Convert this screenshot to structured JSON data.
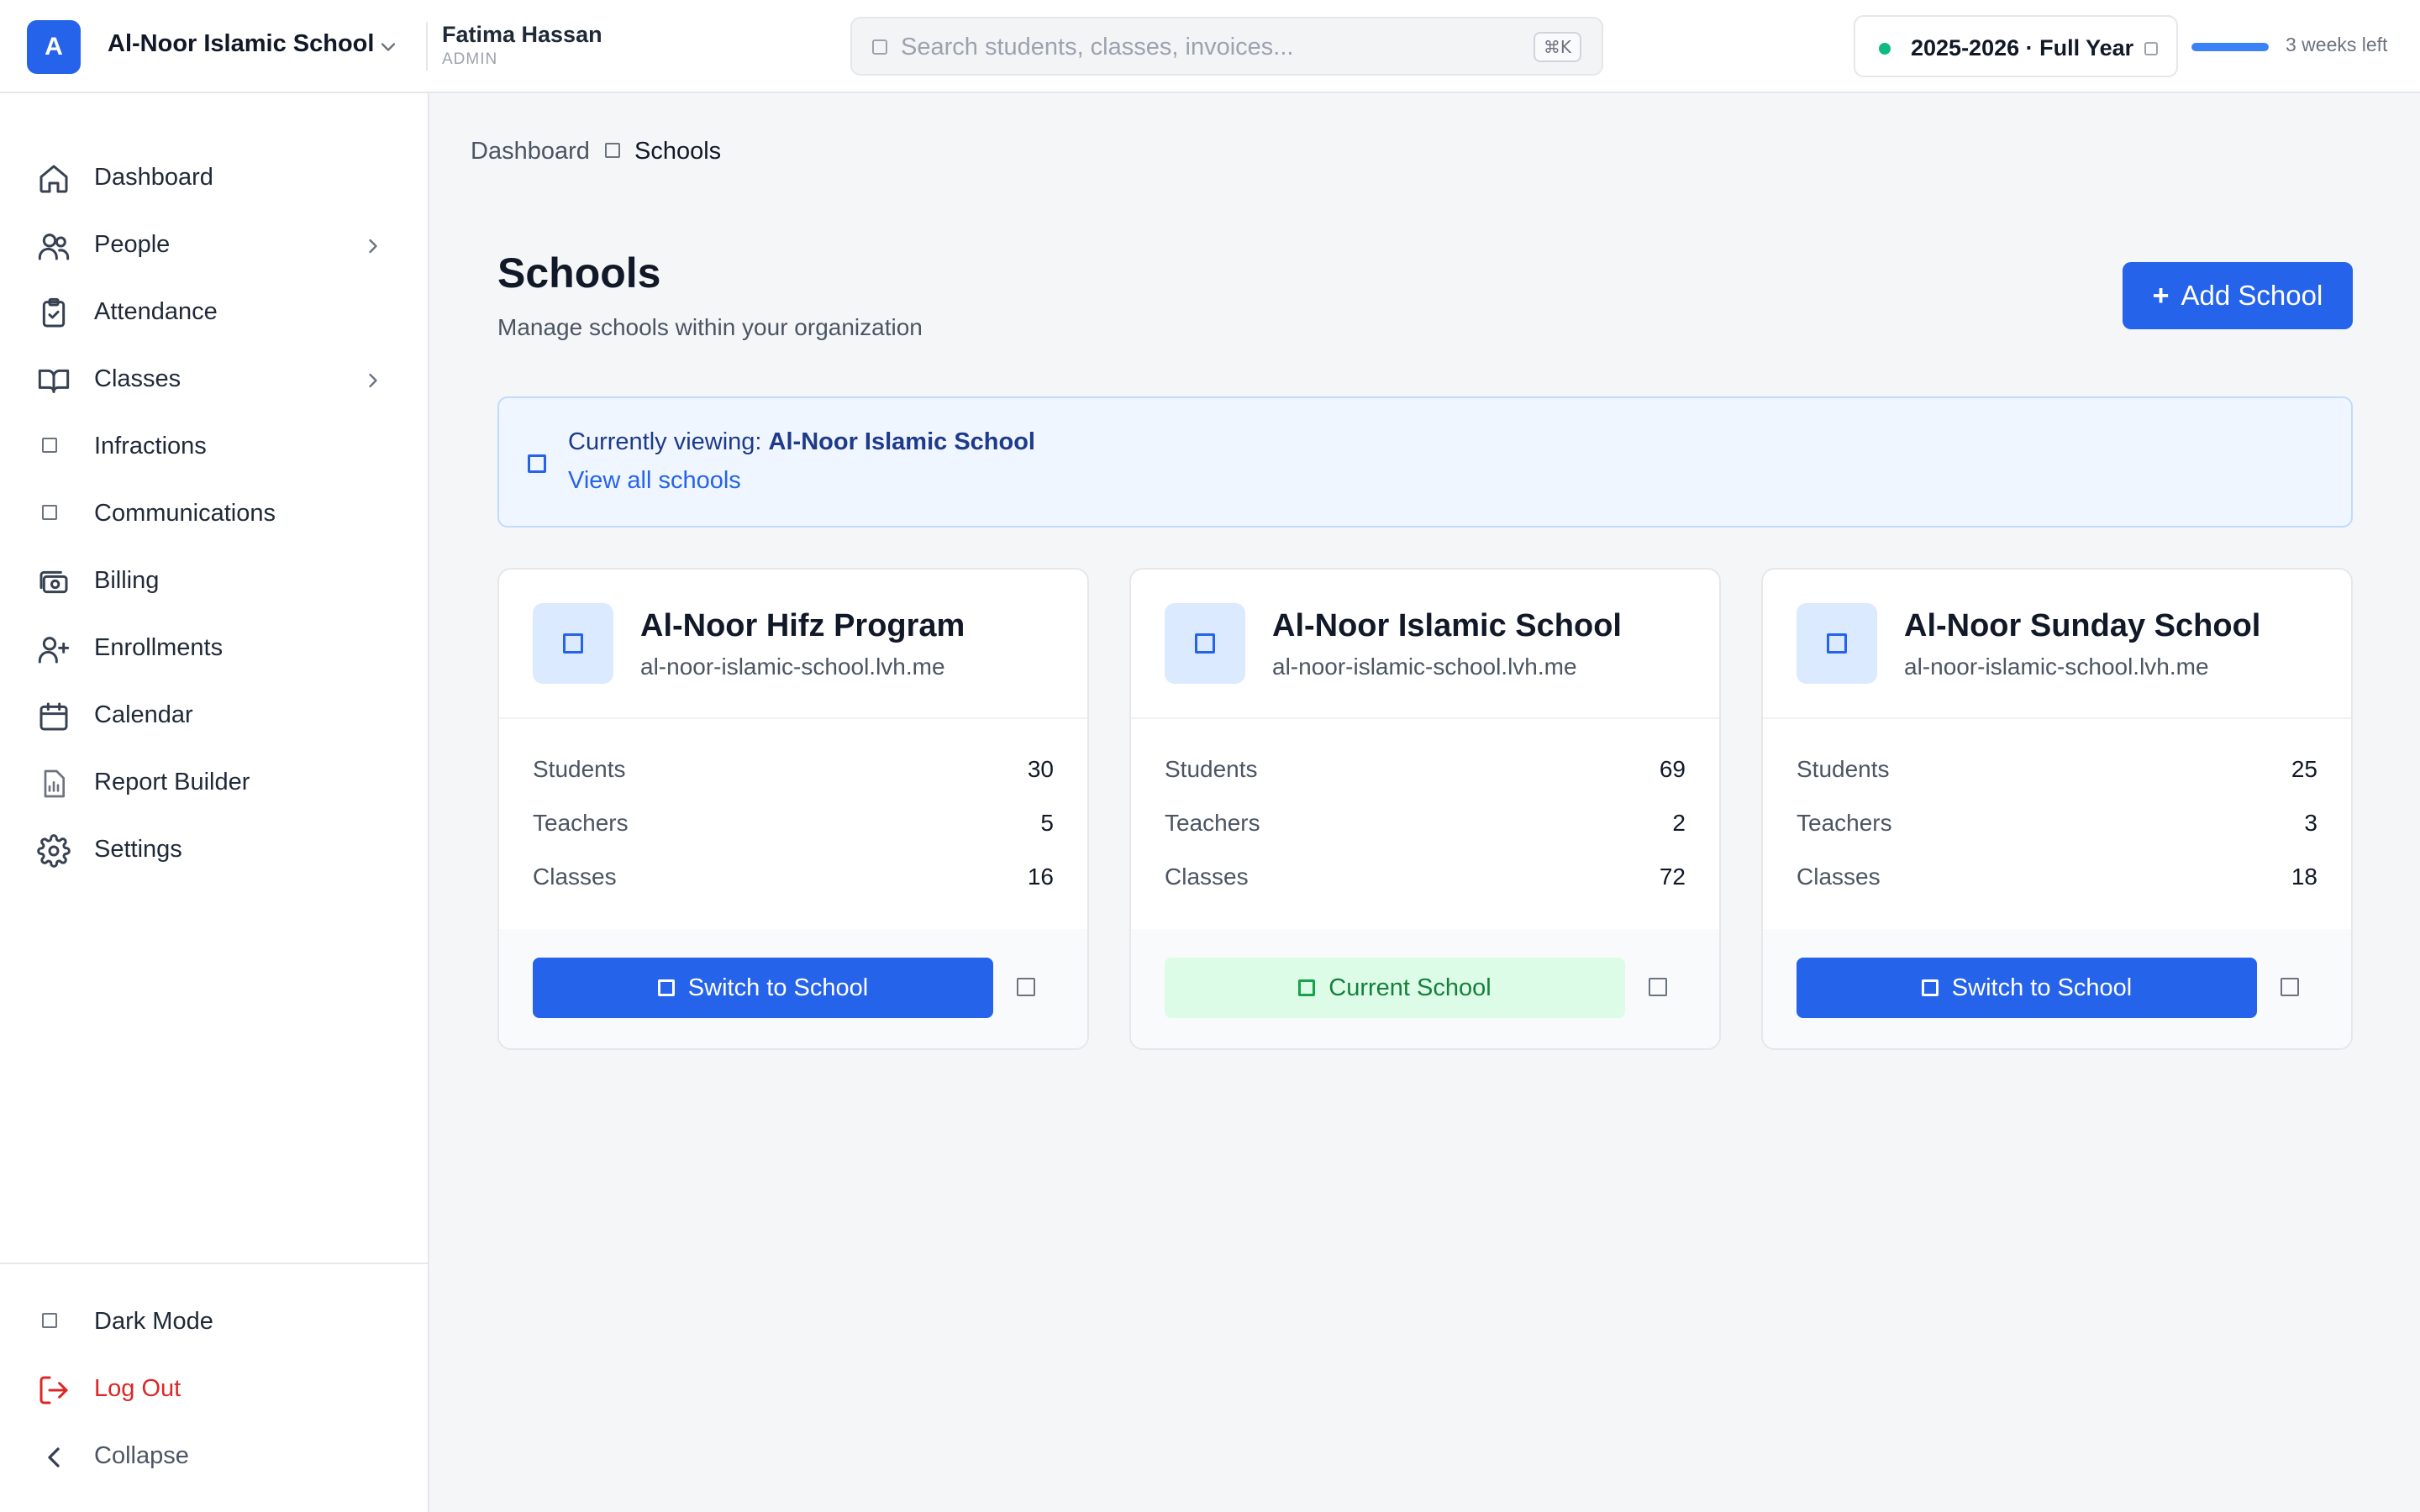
{
  "header": {
    "org_initial": "A",
    "org_name": "Al-Noor Islamic School",
    "user_name": "Fatima Hassan",
    "user_role": "ADMIN",
    "search_placeholder": "Search students, classes, invoices...",
    "search_shortcut": "⌘K",
    "academic_year": "2025-2026 · Full Year",
    "year_status_color": "#10b981",
    "year_progress_percent": 100,
    "time_left": "3 weeks left"
  },
  "sidebar": {
    "items": [
      {
        "label": "Dashboard",
        "icon": "home-icon"
      },
      {
        "label": "People",
        "icon": "users-icon",
        "has_submenu": true
      },
      {
        "label": "Attendance",
        "icon": "clipboard-check-icon"
      },
      {
        "label": "Classes",
        "icon": "book-open-icon",
        "has_submenu": true
      },
      {
        "label": "Infractions",
        "icon": "infractions-icon"
      },
      {
        "label": "Communications",
        "icon": "communications-icon"
      },
      {
        "label": "Billing",
        "icon": "billing-icon"
      },
      {
        "label": "Enrollments",
        "icon": "user-plus-icon"
      },
      {
        "label": "Calendar",
        "icon": "calendar-icon"
      },
      {
        "label": "Report Builder",
        "icon": "report-icon"
      },
      {
        "label": "Settings",
        "icon": "gear-icon"
      }
    ],
    "bottom": {
      "dark_mode": "Dark Mode",
      "log_out": "Log Out",
      "collapse": "Collapse"
    }
  },
  "breadcrumb": {
    "home": "Dashboard",
    "current": "Schools"
  },
  "page": {
    "title": "Schools",
    "subtitle": "Manage schools within your organization",
    "add_button": "Add School"
  },
  "viewing": {
    "prefix": "Currently viewing:",
    "school": "Al-Noor Islamic School",
    "link": "View all schools"
  },
  "schools": [
    {
      "name": "Al-Noor Hifz Program",
      "domain": "al-noor-islamic-school.lvh.me",
      "stats": [
        {
          "label": "Students",
          "value": "30"
        },
        {
          "label": "Teachers",
          "value": "5"
        },
        {
          "label": "Classes",
          "value": "16"
        }
      ],
      "action": "Switch to School",
      "is_current": false
    },
    {
      "name": "Al-Noor Islamic School",
      "domain": "al-noor-islamic-school.lvh.me",
      "stats": [
        {
          "label": "Students",
          "value": "69"
        },
        {
          "label": "Teachers",
          "value": "2"
        },
        {
          "label": "Classes",
          "value": "72"
        }
      ],
      "action": "Current School",
      "is_current": true
    },
    {
      "name": "Al-Noor Sunday School",
      "domain": "al-noor-islamic-school.lvh.me",
      "stats": [
        {
          "label": "Students",
          "value": "25"
        },
        {
          "label": "Teachers",
          "value": "3"
        },
        {
          "label": "Classes",
          "value": "18"
        }
      ],
      "action": "Switch to School",
      "is_current": false
    }
  ],
  "colors": {
    "primary": "#2563eb",
    "success_bg": "#dcfce7",
    "success_text": "#15803d",
    "danger": "#dc2626"
  }
}
